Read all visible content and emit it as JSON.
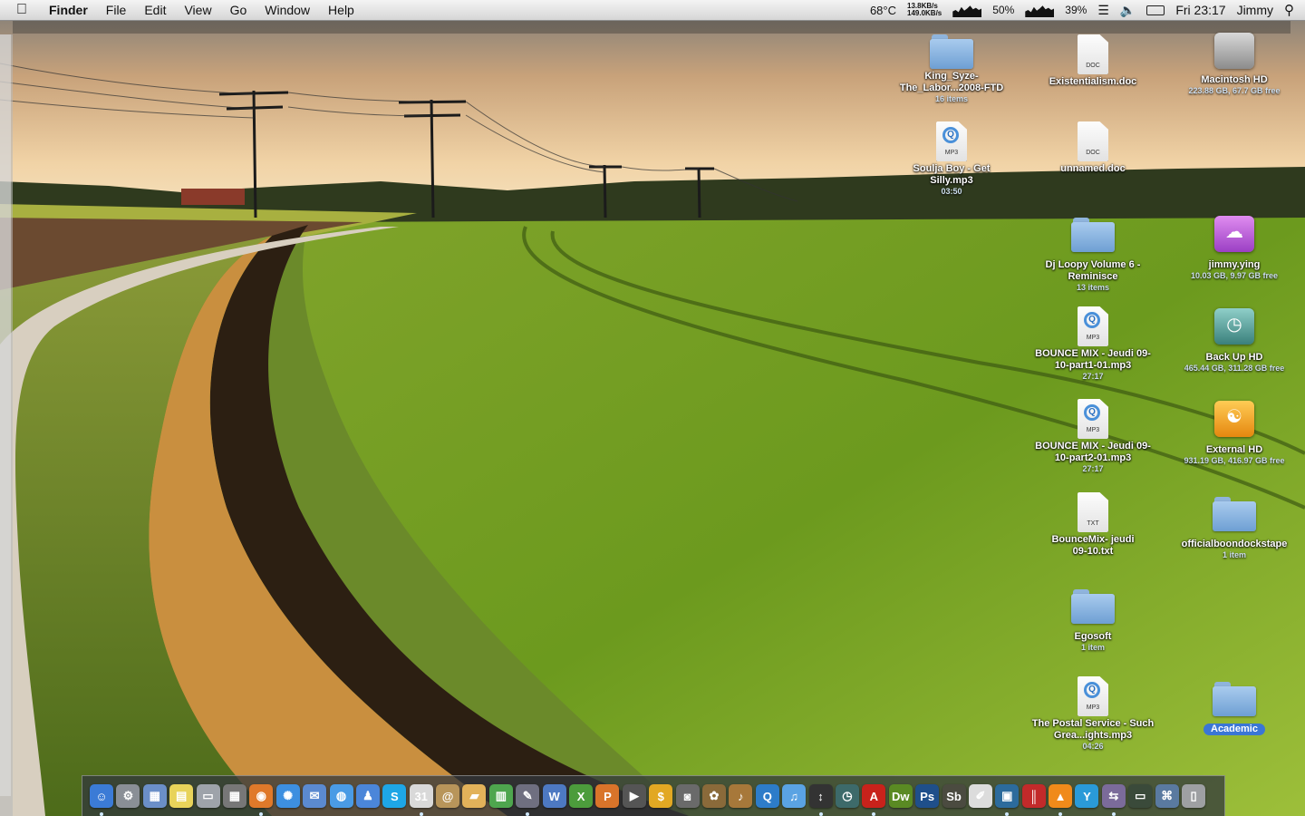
{
  "menubar": {
    "apple_icon": "apple-icon",
    "app_name": "Finder",
    "menus": [
      "File",
      "Edit",
      "View",
      "Go",
      "Window",
      "Help"
    ],
    "status": {
      "temperature": "68°C",
      "net_up": "13.8KB/s",
      "net_down": "149.0KB/s",
      "cpu_percent": "50%",
      "mem_percent": "39%",
      "clock": "Fri 23:17",
      "user": "Jimmy"
    }
  },
  "desktop_icons": {
    "king_syze": {
      "label": "King_Syze-The_Labor...2008-FTD",
      "sub": "16 items"
    },
    "existentialism": {
      "label": "Existentialism.doc",
      "ext": "DOC"
    },
    "macintosh_hd": {
      "label": "Macintosh HD",
      "sub": "223.88 GB, 67.7 GB free"
    },
    "soulja_boy": {
      "label": "Soulja Boy - Get Silly.mp3",
      "sub": "03:50",
      "ext": "MP3"
    },
    "unnamed": {
      "label": "unnamed.doc",
      "ext": "DOC"
    },
    "dj_loopy": {
      "label": "Dj Loopy Volume 6 - Reminisce",
      "sub": "13 items"
    },
    "jimmy_ying": {
      "label": "jimmy.ying",
      "sub": "10.03 GB, 9.97 GB free"
    },
    "bounce_part1": {
      "label": "BOUNCE MIX - Jeudi 09-10-part1-01.mp3",
      "sub": "27:17",
      "ext": "MP3"
    },
    "back_up_hd": {
      "label": "Back Up HD",
      "sub": "465.44 GB, 311.28 GB free"
    },
    "bounce_part2": {
      "label": "BOUNCE MIX - Jeudi 09-10-part2-01.mp3",
      "sub": "27:17",
      "ext": "MP3"
    },
    "external_hd": {
      "label": "External HD",
      "sub": "931.19 GB, 416.97 GB free"
    },
    "bouncemix_txt": {
      "label": "BounceMix- jeudi 09-10.txt",
      "ext": "TXT"
    },
    "officialboondocks": {
      "label": "officialboondockstape",
      "sub": "1 item"
    },
    "egosoft": {
      "label": "Egosoft",
      "sub": "1 item"
    },
    "postal_service": {
      "label": "The Postal Service - Such Grea...ights.mp3",
      "sub": "04:26",
      "ext": "MP3"
    },
    "academic": {
      "label": "Academic"
    }
  },
  "dock": {
    "items": [
      {
        "name": "finder-icon",
        "glyph": "☺",
        "color": "#3b7bd6"
      },
      {
        "name": "system-preferences-icon",
        "glyph": "⚙",
        "color": "#8a8f96"
      },
      {
        "name": "preview-icon",
        "glyph": "▦",
        "color": "#6b8fc8"
      },
      {
        "name": "stickies-icon",
        "glyph": "▤",
        "color": "#e8d35a"
      },
      {
        "name": "scanner-icon",
        "glyph": "▭",
        "color": "#9ea3aa"
      },
      {
        "name": "calculator-icon",
        "glyph": "▦",
        "color": "#777"
      },
      {
        "name": "firefox-icon",
        "glyph": "◉",
        "color": "#e0792a"
      },
      {
        "name": "safari-icon",
        "glyph": "✺",
        "color": "#3d8fe0"
      },
      {
        "name": "mail-icon",
        "glyph": "✉",
        "color": "#5b8ad0"
      },
      {
        "name": "ichat-icon",
        "glyph": "◍",
        "color": "#4a9be5"
      },
      {
        "name": "address-book-icon",
        "glyph": "♟",
        "color": "#4b86d9"
      },
      {
        "name": "skype-icon",
        "glyph": "S",
        "color": "#1ea6e6"
      },
      {
        "name": "ical-icon",
        "glyph": "31",
        "color": "#d9d9d9"
      },
      {
        "name": "address-card-icon",
        "glyph": "@",
        "color": "#b8955a"
      },
      {
        "name": "keynote-icon",
        "glyph": "▰",
        "color": "#e2b25a"
      },
      {
        "name": "numbers-icon",
        "glyph": "▥",
        "color": "#4ea64e"
      },
      {
        "name": "script-editor-icon",
        "glyph": "✎",
        "color": "#6f6f80"
      },
      {
        "name": "word-icon",
        "glyph": "W",
        "color": "#4d79c2"
      },
      {
        "name": "excel-icon",
        "glyph": "X",
        "color": "#4c9c3c"
      },
      {
        "name": "powerpoint-icon",
        "glyph": "P",
        "color": "#d9742a"
      },
      {
        "name": "imovie-icon",
        "glyph": "▶",
        "color": "#555"
      },
      {
        "name": "money-icon",
        "glyph": "$",
        "color": "#e2a823"
      },
      {
        "name": "photo-booth-icon",
        "glyph": "◙",
        "color": "#6a6a6a"
      },
      {
        "name": "iphoto-icon",
        "glyph": "✿",
        "color": "#8a6a3a"
      },
      {
        "name": "garageband-icon",
        "glyph": "♪",
        "color": "#a7783a"
      },
      {
        "name": "quicktime-icon",
        "glyph": "Q",
        "color": "#2d7cc9"
      },
      {
        "name": "itunes-icon",
        "glyph": "♫",
        "color": "#5aa3e3"
      },
      {
        "name": "network-meter-icon",
        "glyph": "↕",
        "color": "#333"
      },
      {
        "name": "time-machine-icon",
        "glyph": "◷",
        "color": "#3d6a6a"
      },
      {
        "name": "acrobat-icon",
        "glyph": "A",
        "color": "#c8221b"
      },
      {
        "name": "dreamweaver-icon",
        "glyph": "Dw",
        "color": "#5a8a23"
      },
      {
        "name": "photoshop-icon",
        "glyph": "Ps",
        "color": "#1f4f8a"
      },
      {
        "name": "soundbooth-icon",
        "glyph": "Sb",
        "color": "#4b4b40"
      },
      {
        "name": "textedit-icon",
        "glyph": "✐",
        "color": "#dcdcdc"
      },
      {
        "name": "activity-monitor-icon",
        "glyph": "▣",
        "color": "#2c6b9c"
      },
      {
        "name": "parallels-icon",
        "glyph": "║",
        "color": "#c22a2a"
      },
      {
        "name": "vlc-icon",
        "glyph": "▲",
        "color": "#f08a1a"
      },
      {
        "name": "yep-icon",
        "glyph": "Y",
        "color": "#2a9ad8"
      },
      {
        "name": "utility-icon",
        "glyph": "⇆",
        "color": "#7b6b9a"
      },
      {
        "name": "console-icon",
        "glyph": "▭",
        "color": "#3a4a3a"
      },
      {
        "name": "network-utility-icon",
        "glyph": "⌘",
        "color": "#5a7aa0"
      },
      {
        "name": "trash-icon",
        "glyph": "▯",
        "color": "#9ea0a3"
      }
    ]
  }
}
